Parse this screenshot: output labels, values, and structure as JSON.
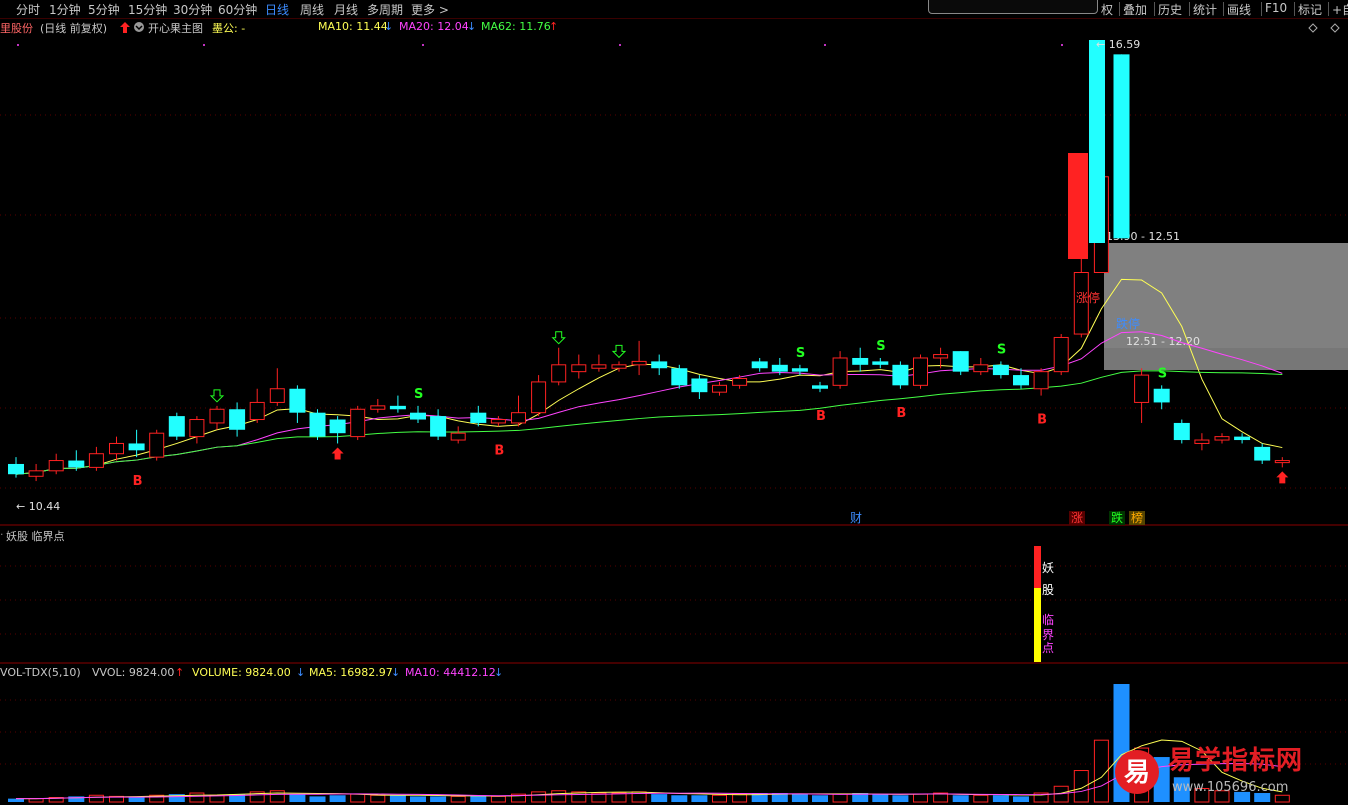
{
  "toolbar": {
    "periods": [
      "分时",
      "1分钟",
      "5分钟",
      "15分钟",
      "30分钟",
      "60分钟",
      "日线",
      "周线",
      "月线",
      "多周期",
      "更多 >"
    ],
    "active_period": "日线",
    "right_buttons": [
      "权",
      "叠加",
      "历史",
      "统计",
      "画线",
      "F10",
      "标记",
      "+自"
    ]
  },
  "header": {
    "stock": "里股份",
    "mode": "(日线 前复权)",
    "indicator_name": "开心果主图",
    "label_yellow": "墨公: -",
    "ma10": "MA10: 11.44",
    "ma20": "MA20: 12.04",
    "ma62": "MA62: 11.76",
    "colors": {
      "ma10": "#ffff55",
      "ma20": "#ff44ff",
      "ma62": "#44ff44",
      "up": "#ff2222",
      "down": "#22ffff"
    }
  },
  "price_chart": {
    "annotations": {
      "high": "16.59",
      "low": "10.44",
      "zone_top": "13.90 - 12.51",
      "zone_bottom": "12.51 - 12.20",
      "limit_up": "涨停",
      "limit_down": "跌停",
      "markers": [
        "财",
        "涨",
        "跌",
        "榜"
      ]
    },
    "price_range": [
      10.0,
      16.8
    ],
    "candles": [
      [
        10.6,
        10.45,
        10.7,
        10.4
      ],
      [
        10.42,
        10.5,
        10.6,
        10.35
      ],
      [
        10.5,
        10.65,
        10.75,
        10.45
      ],
      [
        10.65,
        10.55,
        10.8,
        10.5
      ],
      [
        10.55,
        10.75,
        10.85,
        10.5
      ],
      [
        10.75,
        10.9,
        11.0,
        10.65
      ],
      [
        10.9,
        10.8,
        11.1,
        10.7
      ],
      [
        10.7,
        11.05,
        11.1,
        10.65
      ],
      [
        11.3,
        11.0,
        11.35,
        10.95
      ],
      [
        11.0,
        11.25,
        11.3,
        10.9
      ],
      [
        11.2,
        11.4,
        11.45,
        11.1
      ],
      [
        11.4,
        11.1,
        11.5,
        11.0
      ],
      [
        11.25,
        11.5,
        11.7,
        11.2
      ],
      [
        11.5,
        11.7,
        12.0,
        11.45
      ],
      [
        11.7,
        11.35,
        11.75,
        11.2
      ],
      [
        11.35,
        11.0,
        11.4,
        10.95
      ],
      [
        11.25,
        11.05,
        11.3,
        10.9
      ],
      [
        11.0,
        11.4,
        11.45,
        10.95
      ],
      [
        11.4,
        11.45,
        11.55,
        11.35
      ],
      [
        11.45,
        11.4,
        11.6,
        11.35
      ],
      [
        11.35,
        11.25,
        11.45,
        11.2
      ],
      [
        11.3,
        11.0,
        11.4,
        10.95
      ],
      [
        10.95,
        11.05,
        11.15,
        10.9
      ],
      [
        11.35,
        11.2,
        11.45,
        11.15
      ],
      [
        11.2,
        11.25,
        11.3,
        11.15
      ],
      [
        11.2,
        11.35,
        11.6,
        11.15
      ],
      [
        11.35,
        11.8,
        11.9,
        11.3
      ],
      [
        11.8,
        12.05,
        12.3,
        11.75
      ],
      [
        11.95,
        12.05,
        12.2,
        11.85
      ],
      [
        12.0,
        12.05,
        12.2,
        11.95
      ],
      [
        12.0,
        12.05,
        12.1,
        11.95
      ],
      [
        12.05,
        12.1,
        12.4,
        11.9
      ],
      [
        12.1,
        12.0,
        12.2,
        11.9
      ],
      [
        12.0,
        11.75,
        12.05,
        11.7
      ],
      [
        11.85,
        11.65,
        11.9,
        11.55
      ],
      [
        11.65,
        11.75,
        11.8,
        11.6
      ],
      [
        11.75,
        11.85,
        11.9,
        11.7
      ],
      [
        12.1,
        12.0,
        12.15,
        11.95
      ],
      [
        12.05,
        11.95,
        12.15,
        11.9
      ],
      [
        12.0,
        11.95,
        12.05,
        11.9
      ],
      [
        11.75,
        11.7,
        11.8,
        11.65
      ],
      [
        11.75,
        12.15,
        12.25,
        11.7
      ],
      [
        12.15,
        12.05,
        12.3,
        11.95
      ],
      [
        12.1,
        12.05,
        12.15,
        12.0
      ],
      [
        12.05,
        11.75,
        12.1,
        11.7
      ],
      [
        11.75,
        12.15,
        12.2,
        11.7
      ],
      [
        12.15,
        12.2,
        12.3,
        12.0
      ],
      [
        12.25,
        11.95,
        12.25,
        11.9
      ],
      [
        11.95,
        12.05,
        12.15,
        11.9
      ],
      [
        12.05,
        11.9,
        12.1,
        11.85
      ],
      [
        11.9,
        11.75,
        12.0,
        11.7
      ],
      [
        11.7,
        11.95,
        12.0,
        11.6
      ],
      [
        11.95,
        12.45,
        12.5,
        11.9
      ],
      [
        12.5,
        13.4,
        13.6,
        12.45
      ],
      [
        13.4,
        14.8,
        15.2,
        13.4
      ],
      [
        16.59,
        13.9,
        16.59,
        13.9
      ],
      [
        11.5,
        11.9,
        12.0,
        11.2
      ],
      [
        11.7,
        11.5,
        11.75,
        11.4
      ],
      [
        11.2,
        10.95,
        11.25,
        10.9
      ],
      [
        10.9,
        10.95,
        11.05,
        10.8
      ],
      [
        10.95,
        11.0,
        11.05,
        10.9
      ],
      [
        11.0,
        10.95,
        11.05,
        10.9
      ],
      [
        10.85,
        10.65,
        10.9,
        10.6
      ],
      [
        10.62,
        10.65,
        10.7,
        10.55
      ]
    ],
    "signals": {
      "B": [
        6,
        24,
        40,
        44,
        51
      ],
      "S": [
        20,
        39,
        43,
        49,
        57
      ],
      "green_arrow": [
        10,
        27,
        30
      ],
      "red_arrow": [
        16,
        63
      ]
    }
  },
  "indicator_panel": {
    "title": "妖股 临界点",
    "labels": [
      "妖",
      "股",
      "临",
      "界",
      "点"
    ]
  },
  "volume_panel": {
    "indicator": "VOL-TDX(5,10)",
    "vvol": "VVOL: 9824.00",
    "volume": "VOLUME: 9824.00",
    "ma5": "MA5: 16982.97",
    "ma10": "MA10: 44412.12",
    "volumes": [
      3,
      3,
      4,
      5,
      6,
      5,
      4,
      6,
      7,
      8,
      6,
      7,
      9,
      10,
      7,
      5,
      6,
      7,
      6,
      6,
      5,
      5,
      5,
      6,
      5,
      7,
      9,
      10,
      9,
      8,
      8,
      9,
      7,
      6,
      6,
      6,
      7,
      8,
      8,
      7,
      6,
      7,
      8,
      7,
      6,
      7,
      8,
      6,
      6,
      6,
      5,
      8,
      14,
      28,
      55,
      105,
      48,
      40,
      22,
      12,
      10,
      9,
      8,
      6
    ]
  },
  "watermark": {
    "logo_char": "易",
    "brand": "易学指标网",
    "url": "www.105696.com"
  }
}
